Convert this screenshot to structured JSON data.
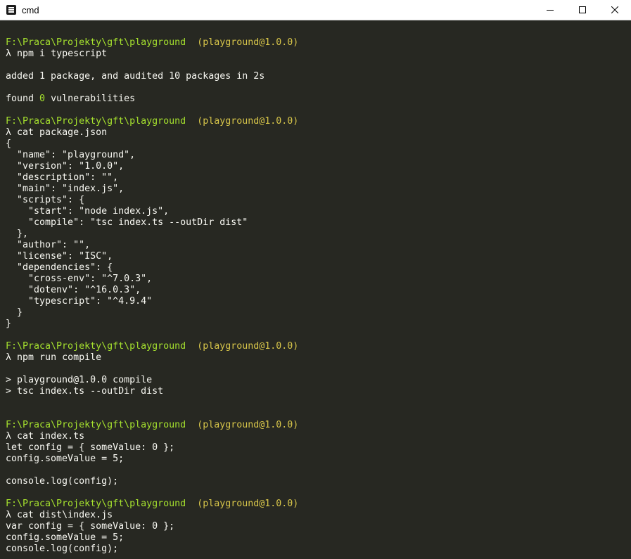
{
  "window": {
    "title": "cmd",
    "minimize_symbol": "minimize-icon",
    "maximize_symbol": "maximize-icon",
    "close_symbol": "close-icon"
  },
  "colors": {
    "background": "#272822",
    "text": "#f8f8f2",
    "path": "#a6e22e",
    "package": "#d8c64a"
  },
  "console": {
    "prompt_path": "F:\\Praca\\Projekty\\gft\\playground",
    "prompt_package": "(playground@1.0.0)",
    "prompt_symbol": "λ",
    "blocks": [
      {
        "command": "npm i typescript",
        "output": [
          "",
          "added 1 package, and audited 10 packages in 2s",
          "",
          "found 0 vulnerabilities",
          ""
        ]
      },
      {
        "command": "cat package.json",
        "output": [
          "{",
          "  \"name\": \"playground\",",
          "  \"version\": \"1.0.0\",",
          "  \"description\": \"\",",
          "  \"main\": \"index.js\",",
          "  \"scripts\": {",
          "    \"start\": \"node index.js\",",
          "    \"compile\": \"tsc index.ts --outDir dist\"",
          "  },",
          "  \"author\": \"\",",
          "  \"license\": \"ISC\",",
          "  \"dependencies\": {",
          "    \"cross-env\": \"^7.0.3\",",
          "    \"dotenv\": \"^16.0.3\",",
          "    \"typescript\": \"^4.9.4\"",
          "  }",
          "}",
          ""
        ]
      },
      {
        "command": "npm run compile",
        "output": [
          "",
          "> playground@1.0.0 compile",
          "> tsc index.ts --outDir dist",
          "",
          ""
        ]
      },
      {
        "command": "cat index.ts",
        "output": [
          "let config = { someValue: 0 };",
          "config.someValue = 5;",
          "",
          "console.log(config);",
          ""
        ]
      },
      {
        "command": "cat dist\\index.js",
        "output": [
          "var config = { someValue: 0 };",
          "config.someValue = 5;",
          "console.log(config);"
        ]
      }
    ]
  }
}
